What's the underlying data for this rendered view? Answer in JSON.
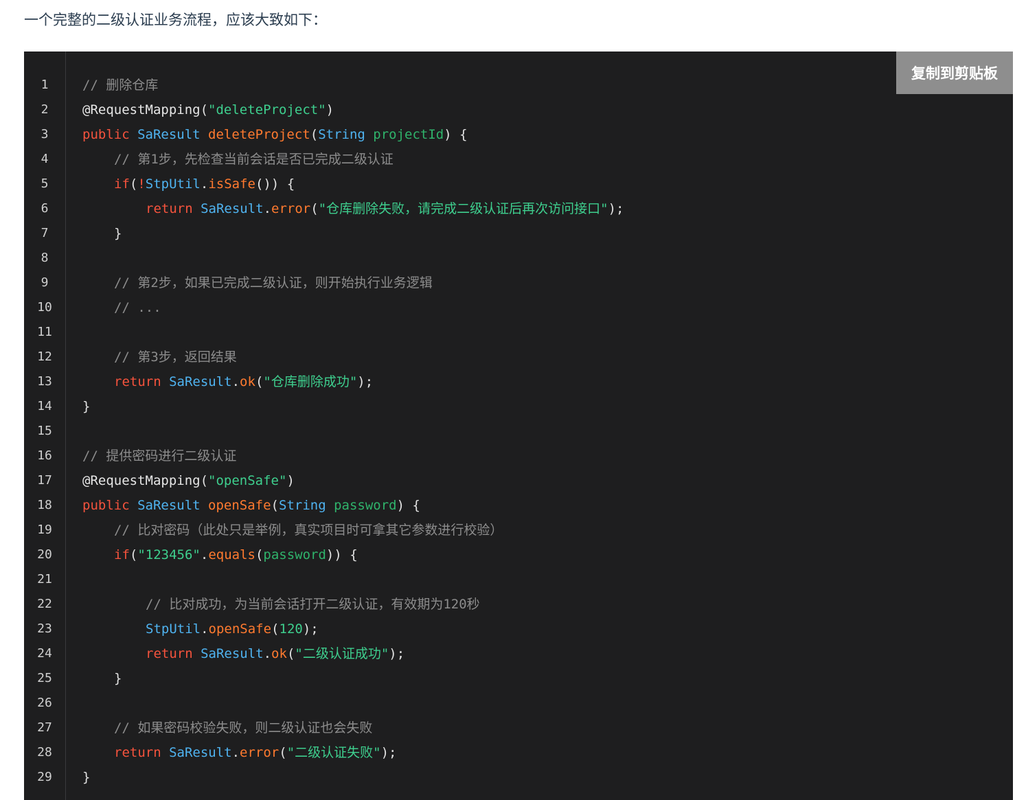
{
  "intro": "一个完整的二级认证业务流程，应该大致如下：",
  "copy_button": "复制到剪贴板",
  "line_numbers": [
    "1",
    "2",
    "3",
    "4",
    "5",
    "6",
    "7",
    "8",
    "9",
    "10",
    "11",
    "12",
    "13",
    "14",
    "15",
    "16",
    "17",
    "18",
    "19",
    "20",
    "21",
    "22",
    "23",
    "24",
    "25",
    "26",
    "27",
    "28",
    "29"
  ],
  "code_lines": [
    {
      "indent": 0,
      "tokens": [
        [
          "comment",
          "// 删除仓库"
        ]
      ]
    },
    {
      "indent": 0,
      "tokens": [
        [
          "anno",
          "@RequestMapping"
        ],
        [
          "plain",
          "("
        ],
        [
          "str",
          "\"deleteProject\""
        ],
        [
          "plain",
          ")"
        ]
      ]
    },
    {
      "indent": 0,
      "tokens": [
        [
          "kw",
          "public "
        ],
        [
          "type",
          "SaResult "
        ],
        [
          "fn",
          "deleteProject"
        ],
        [
          "plain",
          "("
        ],
        [
          "type",
          "String "
        ],
        [
          "param",
          "projectId"
        ],
        [
          "plain",
          ") {"
        ]
      ]
    },
    {
      "indent": 1,
      "tokens": [
        [
          "comment",
          "// 第1步，先检查当前会话是否已完成二级认证"
        ]
      ]
    },
    {
      "indent": 1,
      "tokens": [
        [
          "kw",
          "if"
        ],
        [
          "plain",
          "("
        ],
        [
          "kw",
          "!"
        ],
        [
          "type",
          "StpUtil"
        ],
        [
          "plain",
          "."
        ],
        [
          "fn",
          "isSafe"
        ],
        [
          "plain",
          "()) {"
        ]
      ]
    },
    {
      "indent": 2,
      "tokens": [
        [
          "kw",
          "return "
        ],
        [
          "type",
          "SaResult"
        ],
        [
          "plain",
          "."
        ],
        [
          "fn",
          "error"
        ],
        [
          "plain",
          "("
        ],
        [
          "str",
          "\"仓库删除失败，请完成二级认证后再次访问接口\""
        ],
        [
          "plain",
          ");"
        ]
      ]
    },
    {
      "indent": 1,
      "tokens": [
        [
          "plain",
          "}"
        ]
      ]
    },
    {
      "indent": 0,
      "tokens": []
    },
    {
      "indent": 1,
      "tokens": [
        [
          "comment",
          "// 第2步，如果已完成二级认证，则开始执行业务逻辑"
        ]
      ]
    },
    {
      "indent": 1,
      "tokens": [
        [
          "comment",
          "// ..."
        ]
      ]
    },
    {
      "indent": 0,
      "tokens": []
    },
    {
      "indent": 1,
      "tokens": [
        [
          "comment",
          "// 第3步，返回结果"
        ]
      ]
    },
    {
      "indent": 1,
      "tokens": [
        [
          "kw",
          "return "
        ],
        [
          "type",
          "SaResult"
        ],
        [
          "plain",
          "."
        ],
        [
          "fn",
          "ok"
        ],
        [
          "plain",
          "("
        ],
        [
          "str",
          "\"仓库删除成功\""
        ],
        [
          "plain",
          ");"
        ]
      ]
    },
    {
      "indent": 0,
      "tokens": [
        [
          "plain",
          "}"
        ]
      ]
    },
    {
      "indent": 0,
      "tokens": []
    },
    {
      "indent": 0,
      "tokens": [
        [
          "comment",
          "// 提供密码进行二级认证"
        ]
      ]
    },
    {
      "indent": 0,
      "tokens": [
        [
          "anno",
          "@RequestMapping"
        ],
        [
          "plain",
          "("
        ],
        [
          "str",
          "\"openSafe\""
        ],
        [
          "plain",
          ")"
        ]
      ]
    },
    {
      "indent": 0,
      "tokens": [
        [
          "kw",
          "public "
        ],
        [
          "type",
          "SaResult "
        ],
        [
          "fn",
          "openSafe"
        ],
        [
          "plain",
          "("
        ],
        [
          "type",
          "String "
        ],
        [
          "param",
          "password"
        ],
        [
          "plain",
          ") {"
        ]
      ]
    },
    {
      "indent": 1,
      "tokens": [
        [
          "comment",
          "// 比对密码（此处只是举例，真实项目时可拿其它参数进行校验）"
        ]
      ]
    },
    {
      "indent": 1,
      "tokens": [
        [
          "kw",
          "if"
        ],
        [
          "plain",
          "("
        ],
        [
          "str",
          "\"123456\""
        ],
        [
          "plain",
          "."
        ],
        [
          "fn",
          "equals"
        ],
        [
          "plain",
          "("
        ],
        [
          "param",
          "password"
        ],
        [
          "plain",
          ")) {"
        ]
      ]
    },
    {
      "indent": 0,
      "tokens": []
    },
    {
      "indent": 2,
      "tokens": [
        [
          "comment",
          "// 比对成功，为当前会话打开二级认证，有效期为120秒"
        ]
      ]
    },
    {
      "indent": 2,
      "tokens": [
        [
          "type",
          "StpUtil"
        ],
        [
          "plain",
          "."
        ],
        [
          "fn",
          "openSafe"
        ],
        [
          "plain",
          "("
        ],
        [
          "num",
          "120"
        ],
        [
          "plain",
          ");"
        ]
      ]
    },
    {
      "indent": 2,
      "tokens": [
        [
          "kw",
          "return "
        ],
        [
          "type",
          "SaResult"
        ],
        [
          "plain",
          "."
        ],
        [
          "fn",
          "ok"
        ],
        [
          "plain",
          "("
        ],
        [
          "str",
          "\"二级认证成功\""
        ],
        [
          "plain",
          ");"
        ]
      ]
    },
    {
      "indent": 1,
      "tokens": [
        [
          "plain",
          "}"
        ]
      ]
    },
    {
      "indent": 0,
      "tokens": []
    },
    {
      "indent": 1,
      "tokens": [
        [
          "comment",
          "// 如果密码校验失败，则二级认证也会失败"
        ]
      ]
    },
    {
      "indent": 1,
      "tokens": [
        [
          "kw",
          "return "
        ],
        [
          "type",
          "SaResult"
        ],
        [
          "plain",
          "."
        ],
        [
          "fn",
          "error"
        ],
        [
          "plain",
          "("
        ],
        [
          "str",
          "\"二级认证失败\""
        ],
        [
          "plain",
          ");"
        ]
      ]
    },
    {
      "indent": 0,
      "tokens": [
        [
          "plain",
          "}"
        ]
      ]
    }
  ]
}
